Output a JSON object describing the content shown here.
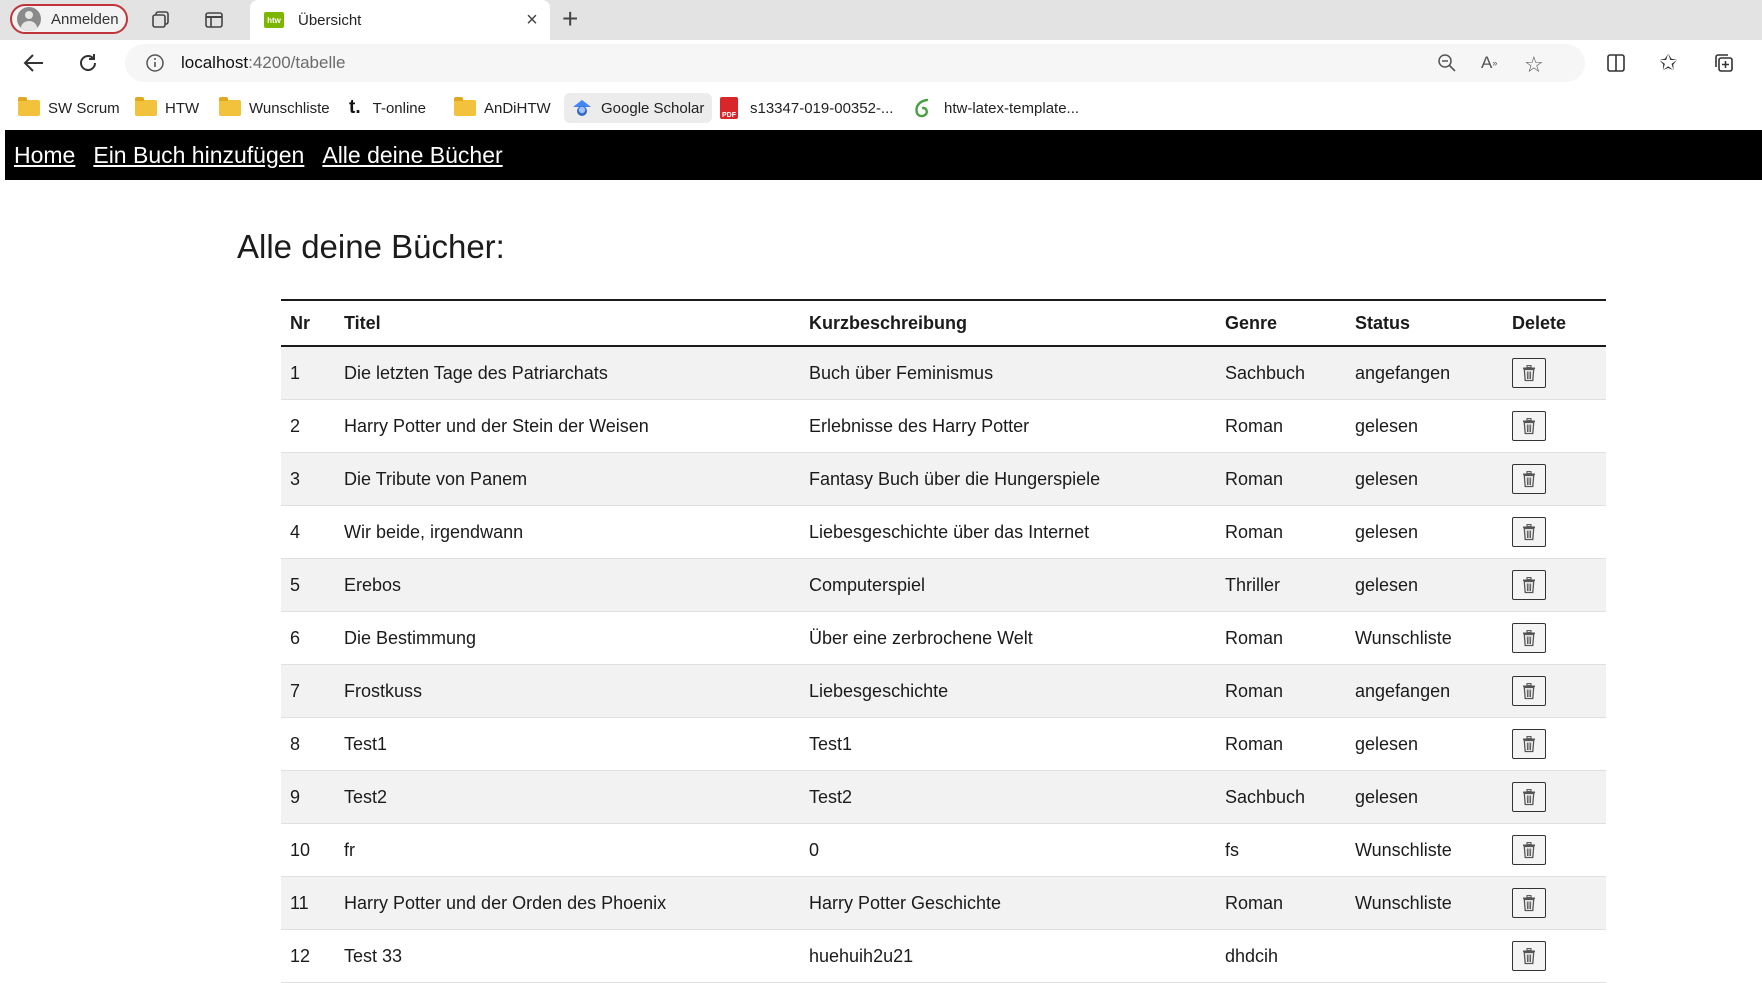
{
  "browser": {
    "profile_label": "Anmelden",
    "tab_title": "Übersicht",
    "tab_favicon_text": "htw",
    "url_host": "localhost",
    "url_path": ":4200/tabelle",
    "bookmarks": [
      {
        "label": "SW Scrum",
        "icon": "folder-icon"
      },
      {
        "label": "HTW",
        "icon": "folder-icon"
      },
      {
        "label": "Wunschliste",
        "icon": "folder-icon"
      },
      {
        "label": "T-online",
        "icon": "t-online-icon"
      },
      {
        "label": "AnDiHTW",
        "icon": "folder-icon"
      },
      {
        "label": "Google Scholar",
        "icon": "scholar-icon"
      },
      {
        "label": "s13347-019-00352-...",
        "icon": "pdf-icon"
      },
      {
        "label": "htw-latex-template...",
        "icon": "overleaf-icon"
      }
    ]
  },
  "nav": {
    "home": "Home",
    "add_book": "Ein Buch hinzufügen",
    "all_books": "Alle deine Bücher"
  },
  "page": {
    "title": "Alle deine Bücher:"
  },
  "table": {
    "headers": [
      "Nr",
      "Titel",
      "Kurzbeschreibung",
      "Genre",
      "Status",
      "Delete"
    ],
    "rows": [
      {
        "nr": "1",
        "titel": "Die letzten Tage des Patriarchats",
        "kurz": "Buch über Feminismus",
        "genre": "Sachbuch",
        "status": "angefangen"
      },
      {
        "nr": "2",
        "titel": "Harry Potter und der Stein der Weisen",
        "kurz": "Erlebnisse des Harry Potter",
        "genre": "Roman",
        "status": "gelesen"
      },
      {
        "nr": "3",
        "titel": "Die Tribute von Panem",
        "kurz": "Fantasy Buch über die Hungerspiele",
        "genre": "Roman",
        "status": "gelesen"
      },
      {
        "nr": "4",
        "titel": "Wir beide, irgendwann",
        "kurz": "Liebesgeschichte über das Internet",
        "genre": "Roman",
        "status": "gelesen"
      },
      {
        "nr": "5",
        "titel": "Erebos",
        "kurz": "Computerspiel",
        "genre": "Thriller",
        "status": "gelesen"
      },
      {
        "nr": "6",
        "titel": "Die Bestimmung",
        "kurz": "Über eine zerbrochene Welt",
        "genre": "Roman",
        "status": "Wunschliste"
      },
      {
        "nr": "7",
        "titel": "Frostkuss",
        "kurz": "Liebesgeschichte",
        "genre": "Roman",
        "status": "angefangen"
      },
      {
        "nr": "8",
        "titel": "Test1",
        "kurz": "Test1",
        "genre": "Roman",
        "status": "gelesen"
      },
      {
        "nr": "9",
        "titel": "Test2",
        "kurz": "Test2",
        "genre": "Sachbuch",
        "status": "gelesen"
      },
      {
        "nr": "10",
        "titel": "fr",
        "kurz": "0",
        "genre": "fs",
        "status": "Wunschliste"
      },
      {
        "nr": "11",
        "titel": "Harry Potter und der Orden des Phoenix",
        "kurz": "Harry Potter Geschichte",
        "genre": "Roman",
        "status": "Wunschliste"
      },
      {
        "nr": "12",
        "titel": "Test 33",
        "kurz": "huehuih2u21",
        "genre": "dhdcih",
        "status": ""
      }
    ]
  },
  "colors": {
    "nav_bg": "#000000",
    "profile_border": "#c2343b",
    "favicon": "#7cb600",
    "row_stripe": "#f2f2f2"
  }
}
